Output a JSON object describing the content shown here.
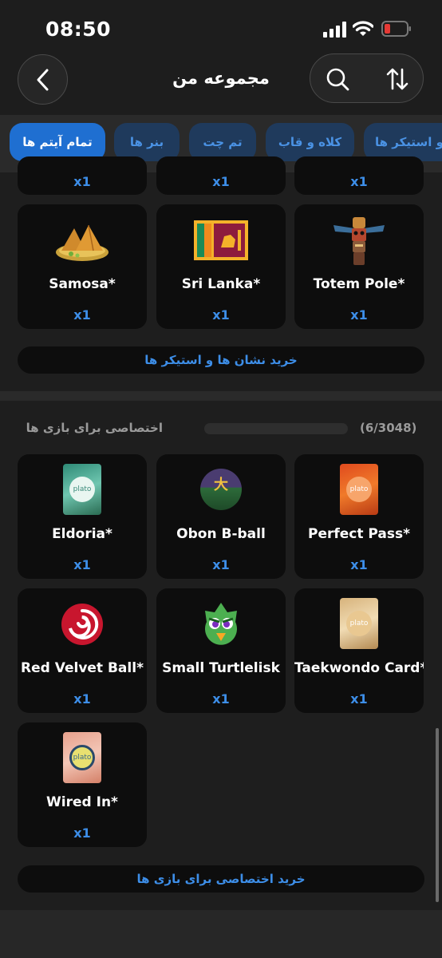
{
  "status": {
    "time": "08:50"
  },
  "header": {
    "title": "مجموعه من"
  },
  "tabs": [
    {
      "label": "تمام آیتم ها"
    },
    {
      "label": "بنر ها"
    },
    {
      "label": "تم چت"
    },
    {
      "label": "کلاه و قاب"
    },
    {
      "label": "و استیکر ها"
    }
  ],
  "section1": {
    "top_row_qty": [
      "x1",
      "x1",
      "x1"
    ],
    "items": [
      {
        "name": "Samosa*",
        "qty": "x1",
        "icon": "samosa-icon"
      },
      {
        "name": "Sri Lanka*",
        "qty": "x1",
        "icon": "sri-lanka-flag-icon"
      },
      {
        "name": "Totem Pole*",
        "qty": "x1",
        "icon": "totem-pole-icon"
      }
    ],
    "buy_label": "خرید نشان ها و استیکر ها"
  },
  "section2": {
    "title": "اختصاصی برای بازی ها",
    "count": "(6/3048)",
    "progress": 0.002,
    "items": [
      {
        "name": "Eldoria*",
        "qty": "x1",
        "icon": "plato-card-icon",
        "logo": "plato"
      },
      {
        "name": "Obon B-ball",
        "qty": "x1",
        "icon": "obon-ball-icon",
        "glyph": "大"
      },
      {
        "name": "Perfect Pass*",
        "qty": "x1",
        "icon": "plato-card-icon",
        "logo": "plato"
      },
      {
        "name": "Red Velvet Ball*",
        "qty": "x1",
        "icon": "red-velvet-ball-icon"
      },
      {
        "name": "Small Turtlelisk",
        "qty": "x1",
        "icon": "turtlelisk-icon"
      },
      {
        "name": "Taekwondo Card*",
        "qty": "x1",
        "icon": "plato-card-icon",
        "logo": "plato"
      },
      {
        "name": "Wired In*",
        "qty": "x1",
        "icon": "plato-card-icon",
        "logo": "plato"
      }
    ],
    "buy_label": "خرید اختصاصی برای بازی ها"
  },
  "colors": {
    "accent": "#1f6fd1",
    "link": "#3d8ee8",
    "card": "#0d0d0d",
    "battery": "#e53935"
  }
}
